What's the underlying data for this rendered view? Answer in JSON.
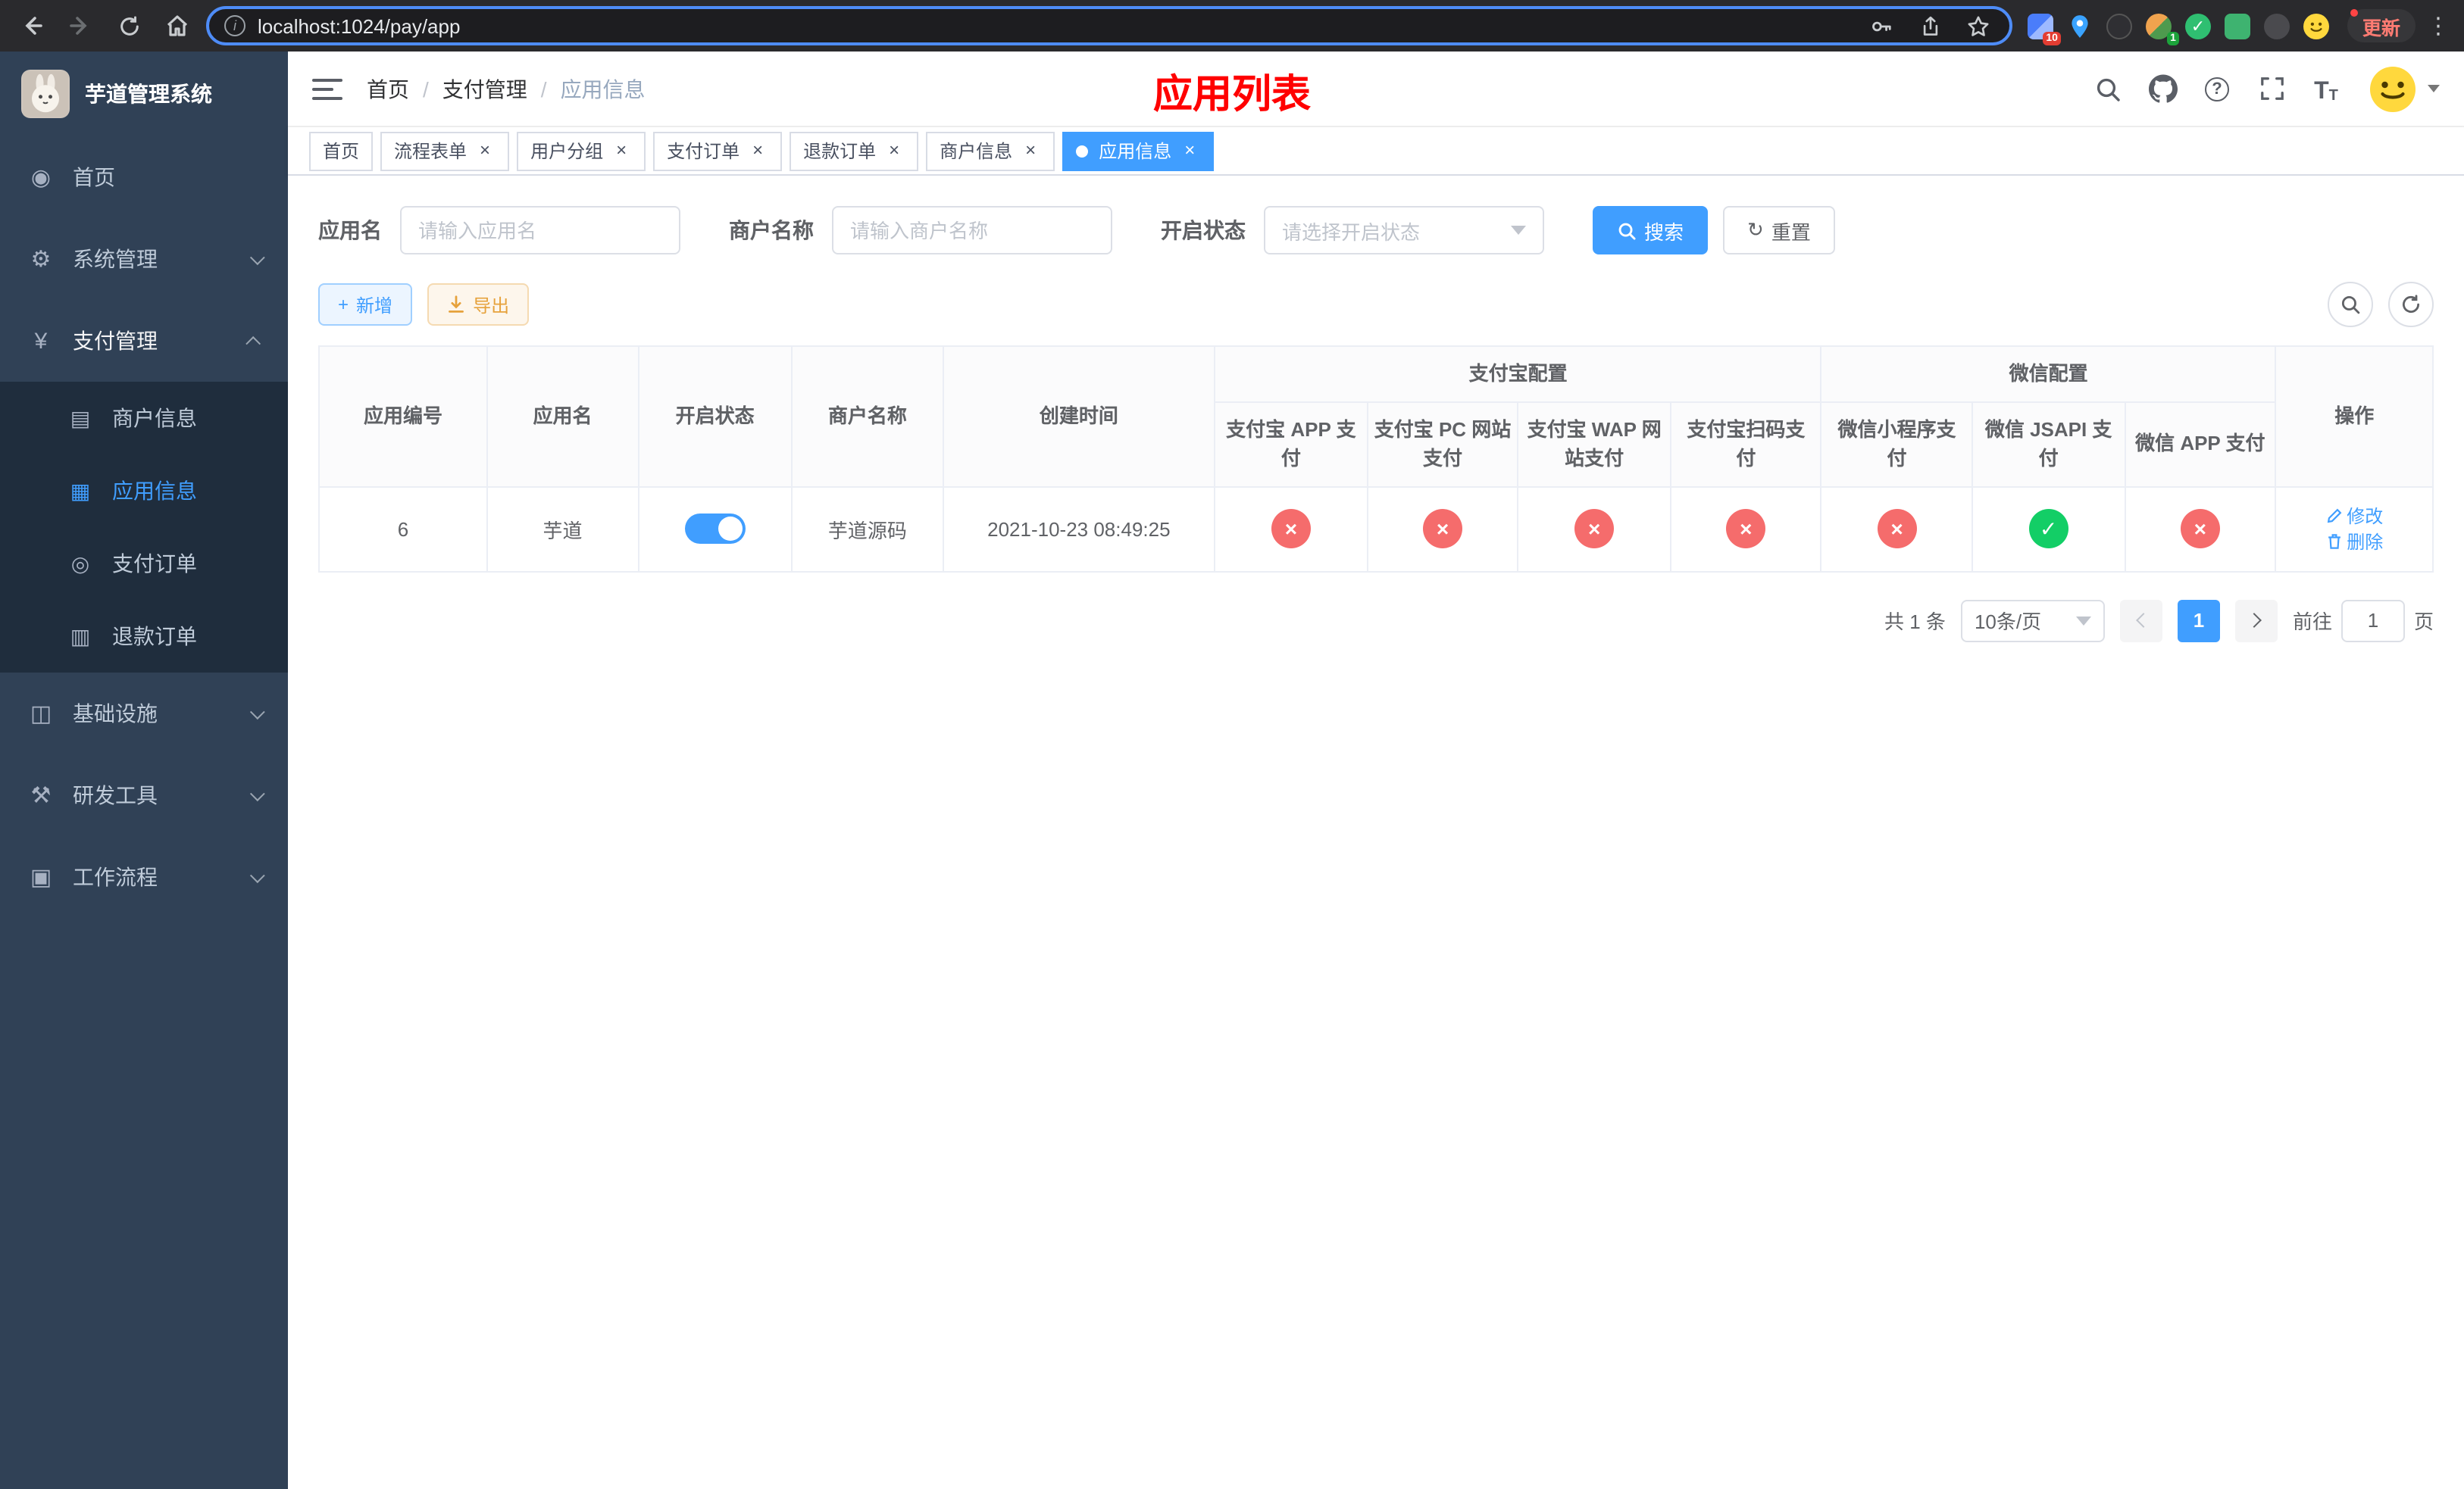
{
  "browser": {
    "url": "localhost:1024/pay/app",
    "update_label": "更新",
    "ext_badge_10": "10",
    "ext_badge_1": "1"
  },
  "icons": {
    "close": "×",
    "check": "✓",
    "cross": "×",
    "question": "?",
    "plus": "+",
    "reset": "↻",
    "info": "i",
    "dots": "⋮",
    "font_large": "T",
    "font_small": "T",
    "vue_check": "✓"
  },
  "sidebar": {
    "app_title": "芋道管理系统",
    "menu": [
      {
        "icon": "◉",
        "label": "首页"
      },
      {
        "icon": "⚙",
        "label": "系统管理"
      },
      {
        "icon": "¥",
        "label": "支付管理"
      },
      {
        "icon": "▤",
        "label": "商户信息"
      },
      {
        "icon": "▦",
        "label": "应用信息"
      },
      {
        "icon": "◎",
        "label": "支付订单"
      },
      {
        "icon": "▥",
        "label": "退款订单"
      },
      {
        "icon": "◫",
        "label": "基础设施"
      },
      {
        "icon": "⚒",
        "label": "研发工具"
      },
      {
        "icon": "▣",
        "label": "工作流程"
      }
    ]
  },
  "navbar": {
    "breadcrumb": {
      "home": "首页",
      "section": "支付管理",
      "current": "应用信息"
    },
    "page_title": "应用列表"
  },
  "tabs": {
    "items": [
      "首页",
      "流程表单",
      "用户分组",
      "支付订单",
      "退款订单",
      "商户信息",
      "应用信息"
    ]
  },
  "filters": {
    "app_name_label": "应用名",
    "app_name_placeholder": "请输入应用名",
    "merchant_label": "商户名称",
    "merchant_placeholder": "请输入商户名称",
    "status_label": "开启状态",
    "status_placeholder": "请选择开启状态",
    "search_label": "搜索",
    "reset_label": "重置"
  },
  "toolbar": {
    "add_label": "新增",
    "export_label": "导出"
  },
  "table": {
    "groups": {
      "alipay": "支付宝配置",
      "wechat": "微信配置"
    },
    "columns": {
      "app_id": "应用编号",
      "app_name": "应用名",
      "status": "开启状态",
      "merchant_name": "商户名称",
      "create_time": "创建时间",
      "alipay_app": "支付宝 APP 支付",
      "alipay_pc": "支付宝 PC 网站支付",
      "alipay_wap": "支付宝 WAP 网站支付",
      "alipay_qr": "支付宝扫码支付",
      "wx_mini": "微信小程序支付",
      "wx_jsapi": "微信 JSAPI 支付",
      "wx_app": "微信 APP 支付",
      "actions": "操作"
    },
    "row": {
      "id": "6",
      "name": "芋道",
      "enabled": true,
      "merchant": "芋道源码",
      "created_at": "2021-10-23 08:49:25",
      "configs": [
        false,
        false,
        false,
        false,
        false,
        true,
        false
      ],
      "edit_label": "修改",
      "delete_label": "删除"
    }
  },
  "pagination": {
    "total_label": "共 1 条",
    "page_size": "10条/页",
    "current_page": "1",
    "goto_prefix": "前往",
    "goto_value": "1",
    "goto_suffix": "页"
  }
}
